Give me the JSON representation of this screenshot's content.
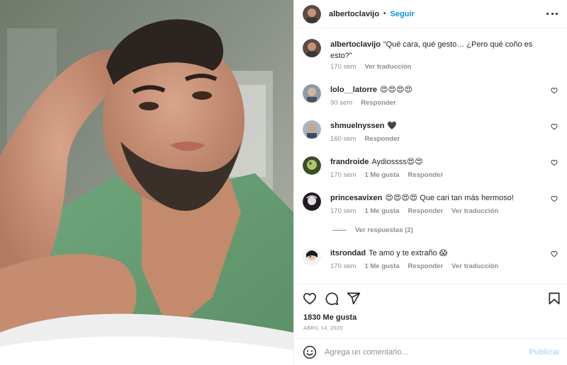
{
  "post": {
    "username": "albertoclavijo",
    "separator": "•",
    "follow_label": "Seguir",
    "more_icon": "more-horizontal-icon",
    "photo_description": "selfie-photo"
  },
  "caption": {
    "username": "albertoclavijo",
    "text": "“Qué cara, qué gesto… ¿Pero qué coño es esto?”",
    "time": "170 sem",
    "translate_label": "Ver traducción"
  },
  "comments": [
    {
      "username": "lolo__latorre",
      "text": "😍😍😍😍",
      "time": "90 sem",
      "likes": "",
      "reply_label": "Responder",
      "translate_label": ""
    },
    {
      "username": "shmuelnyssen",
      "text": "🖤",
      "time": "160 sem",
      "likes": "",
      "reply_label": "Responder",
      "translate_label": ""
    },
    {
      "username": "frandroide",
      "text": "Aydiossss😍😍",
      "time": "170 sem",
      "likes": "1 Me gusta",
      "reply_label": "Responder",
      "translate_label": ""
    },
    {
      "username": "princesavixen",
      "text": "😍😍😍😍 Que cari tan más hermoso!",
      "time": "170 sem",
      "likes": "1 Me gusta",
      "reply_label": "Responder",
      "translate_label": "Ver traducción"
    },
    {
      "username": "itsrondad",
      "text": "Te amo y te extraño 😱",
      "time": "170 sem",
      "likes": "1 Me gusta",
      "reply_label": "Responder",
      "translate_label": "Ver traducción"
    }
  ],
  "view_replies_label": "Ver respuestas (2)",
  "actions": {
    "like_icon": "heart-icon",
    "comment_icon": "comment-icon",
    "share_icon": "send-icon",
    "save_icon": "bookmark-icon"
  },
  "likes_text": "1830 Me gusta",
  "date_text": "ABRIL 14, 2020",
  "composer": {
    "placeholder": "Agrega un comentario...",
    "publish_label": "Publicar",
    "emoji_icon": "emoji-icon"
  },
  "colors": {
    "link_blue": "#0095f6",
    "publish_disabled": "#b2dffc",
    "muted_text": "#8e8e8e",
    "divider": "#efefef"
  }
}
